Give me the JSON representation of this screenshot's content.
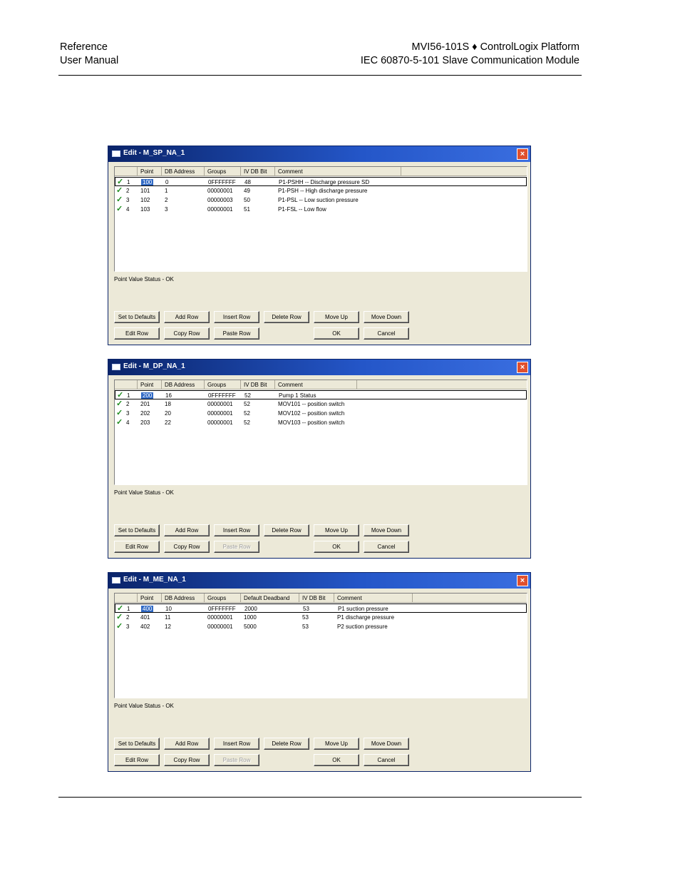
{
  "header": {
    "left_line1": "Reference",
    "left_line2": "User Manual",
    "right_line1": "MVI56-101S ♦ ControlLogix Platform",
    "right_line2": "IEC 60870-5-101 Slave Communication Module"
  },
  "dialogs": [
    {
      "title": "Edit - M_SP_NA_1",
      "close": "×",
      "columns": [
        "Point",
        "DB Address",
        "Groups",
        "IV DB Bit",
        "Comment"
      ],
      "rows": [
        {
          "num": "1",
          "c": [
            "100",
            "0",
            "0FFFFFFF",
            "48",
            "P1-PSHH -- Discharge pressure SD"
          ]
        },
        {
          "num": "2",
          "c": [
            "101",
            "1",
            "00000001",
            "49",
            "P1-PSH  -- High discharge pressure"
          ]
        },
        {
          "num": "3",
          "c": [
            "102",
            "2",
            "00000003",
            "50",
            "P1-PSL  -- Low suction pressure"
          ]
        },
        {
          "num": "4",
          "c": [
            "103",
            "3",
            "00000001",
            "51",
            "P1-FSL  -- Low flow"
          ]
        }
      ],
      "status": "Point Value Status - OK",
      "buttons": {
        "set_defaults": "Set to Defaults",
        "add_row": "Add Row",
        "insert_row": "Insert Row",
        "delete_row": "Delete Row",
        "move_up": "Move Up",
        "move_down": "Move Down",
        "edit_row": "Edit Row",
        "copy_row": "Copy Row",
        "paste_row": "Paste Row",
        "ok": "OK",
        "cancel": "Cancel"
      }
    },
    {
      "title": "Edit - M_DP_NA_1",
      "close": "×",
      "columns": [
        "Point",
        "DB Address",
        "Groups",
        "IV DB Bit",
        "Comment"
      ],
      "rows": [
        {
          "num": "1",
          "c": [
            "200",
            "16",
            "0FFFFFFF",
            "52",
            "Pump 1 Status"
          ]
        },
        {
          "num": "2",
          "c": [
            "201",
            "18",
            "00000001",
            "52",
            "MOV101 -- position switch"
          ]
        },
        {
          "num": "3",
          "c": [
            "202",
            "20",
            "00000001",
            "52",
            "MOV102 -- position switch"
          ]
        },
        {
          "num": "4",
          "c": [
            "203",
            "22",
            "00000001",
            "52",
            "MOV103 -- position switch"
          ]
        }
      ],
      "status": "Point Value Status - OK",
      "buttons": {
        "set_defaults": "Set to Defaults",
        "add_row": "Add Row",
        "insert_row": "Insert Row",
        "delete_row": "Delete Row",
        "move_up": "Move Up",
        "move_down": "Move Down",
        "edit_row": "Edit Row",
        "copy_row": "Copy Row",
        "paste_row": "Paste Row",
        "ok": "OK",
        "cancel": "Cancel"
      }
    },
    {
      "title": "Edit - M_ME_NA_1",
      "close": "×",
      "columns": [
        "Point",
        "DB Address",
        "Groups",
        "Default Deadband",
        "IV DB Bit",
        "Comment"
      ],
      "rows": [
        {
          "num": "1",
          "c": [
            "400",
            "10",
            "0FFFFFFF",
            "2000",
            "53",
            "P1 suction pressure"
          ]
        },
        {
          "num": "2",
          "c": [
            "401",
            "11",
            "00000001",
            "1000",
            "53",
            "P1 discharge pressure"
          ]
        },
        {
          "num": "3",
          "c": [
            "402",
            "12",
            "00000001",
            "5000",
            "53",
            "P2 suction pressure"
          ]
        }
      ],
      "status": "Point Value Status - OK",
      "buttons": {
        "set_defaults": "Set to Defaults",
        "add_row": "Add Row",
        "insert_row": "Insert Row",
        "delete_row": "Delete Row",
        "move_up": "Move Up",
        "move_down": "Move Down",
        "edit_row": "Edit Row",
        "copy_row": "Copy Row",
        "paste_row": "Paste Row",
        "ok": "OK",
        "cancel": "Cancel"
      }
    }
  ]
}
